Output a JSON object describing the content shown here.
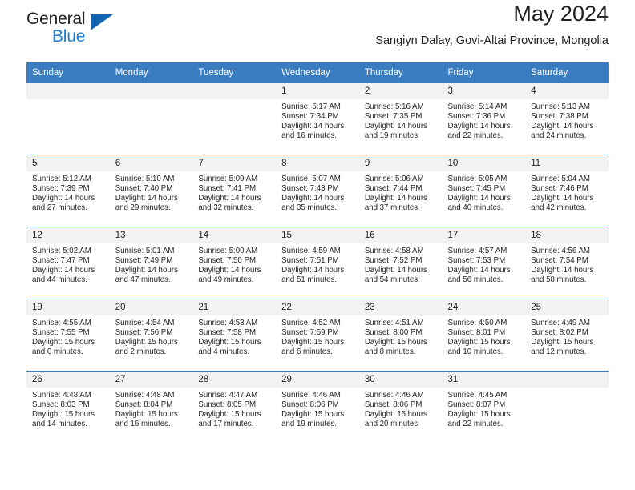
{
  "brand": {
    "name_top": "General",
    "name_bottom": "Blue",
    "accent_color": "#1263b0",
    "accent_color_light": "#1b7fd4"
  },
  "header": {
    "month_title": "May 2024",
    "location": "Sangiyn Dalay, Govi-Altai Province, Mongolia"
  },
  "theme": {
    "header_bg": "#3a7cc0",
    "daynum_bg": "#f2f2f2",
    "text_color": "#231f20"
  },
  "weekday_headers": [
    "Sunday",
    "Monday",
    "Tuesday",
    "Wednesday",
    "Thursday",
    "Friday",
    "Saturday"
  ],
  "labels": {
    "sunrise_prefix": "Sunrise:",
    "sunset_prefix": "Sunset:",
    "daylight_prefix": "Daylight:"
  },
  "weeks": [
    [
      {
        "day": "",
        "sunrise": "",
        "sunset": "",
        "daylight": "",
        "empty": true
      },
      {
        "day": "",
        "sunrise": "",
        "sunset": "",
        "daylight": "",
        "empty": true
      },
      {
        "day": "",
        "sunrise": "",
        "sunset": "",
        "daylight": "",
        "empty": true
      },
      {
        "day": "1",
        "sunrise": "Sunrise: 5:17 AM",
        "sunset": "Sunset: 7:34 PM",
        "daylight": "Daylight: 14 hours and 16 minutes."
      },
      {
        "day": "2",
        "sunrise": "Sunrise: 5:16 AM",
        "sunset": "Sunset: 7:35 PM",
        "daylight": "Daylight: 14 hours and 19 minutes."
      },
      {
        "day": "3",
        "sunrise": "Sunrise: 5:14 AM",
        "sunset": "Sunset: 7:36 PM",
        "daylight": "Daylight: 14 hours and 22 minutes."
      },
      {
        "day": "4",
        "sunrise": "Sunrise: 5:13 AM",
        "sunset": "Sunset: 7:38 PM",
        "daylight": "Daylight: 14 hours and 24 minutes."
      }
    ],
    [
      {
        "day": "5",
        "sunrise": "Sunrise: 5:12 AM",
        "sunset": "Sunset: 7:39 PM",
        "daylight": "Daylight: 14 hours and 27 minutes."
      },
      {
        "day": "6",
        "sunrise": "Sunrise: 5:10 AM",
        "sunset": "Sunset: 7:40 PM",
        "daylight": "Daylight: 14 hours and 29 minutes."
      },
      {
        "day": "7",
        "sunrise": "Sunrise: 5:09 AM",
        "sunset": "Sunset: 7:41 PM",
        "daylight": "Daylight: 14 hours and 32 minutes."
      },
      {
        "day": "8",
        "sunrise": "Sunrise: 5:07 AM",
        "sunset": "Sunset: 7:43 PM",
        "daylight": "Daylight: 14 hours and 35 minutes."
      },
      {
        "day": "9",
        "sunrise": "Sunrise: 5:06 AM",
        "sunset": "Sunset: 7:44 PM",
        "daylight": "Daylight: 14 hours and 37 minutes."
      },
      {
        "day": "10",
        "sunrise": "Sunrise: 5:05 AM",
        "sunset": "Sunset: 7:45 PM",
        "daylight": "Daylight: 14 hours and 40 minutes."
      },
      {
        "day": "11",
        "sunrise": "Sunrise: 5:04 AM",
        "sunset": "Sunset: 7:46 PM",
        "daylight": "Daylight: 14 hours and 42 minutes."
      }
    ],
    [
      {
        "day": "12",
        "sunrise": "Sunrise: 5:02 AM",
        "sunset": "Sunset: 7:47 PM",
        "daylight": "Daylight: 14 hours and 44 minutes."
      },
      {
        "day": "13",
        "sunrise": "Sunrise: 5:01 AM",
        "sunset": "Sunset: 7:49 PM",
        "daylight": "Daylight: 14 hours and 47 minutes."
      },
      {
        "day": "14",
        "sunrise": "Sunrise: 5:00 AM",
        "sunset": "Sunset: 7:50 PM",
        "daylight": "Daylight: 14 hours and 49 minutes."
      },
      {
        "day": "15",
        "sunrise": "Sunrise: 4:59 AM",
        "sunset": "Sunset: 7:51 PM",
        "daylight": "Daylight: 14 hours and 51 minutes."
      },
      {
        "day": "16",
        "sunrise": "Sunrise: 4:58 AM",
        "sunset": "Sunset: 7:52 PM",
        "daylight": "Daylight: 14 hours and 54 minutes."
      },
      {
        "day": "17",
        "sunrise": "Sunrise: 4:57 AM",
        "sunset": "Sunset: 7:53 PM",
        "daylight": "Daylight: 14 hours and 56 minutes."
      },
      {
        "day": "18",
        "sunrise": "Sunrise: 4:56 AM",
        "sunset": "Sunset: 7:54 PM",
        "daylight": "Daylight: 14 hours and 58 minutes."
      }
    ],
    [
      {
        "day": "19",
        "sunrise": "Sunrise: 4:55 AM",
        "sunset": "Sunset: 7:55 PM",
        "daylight": "Daylight: 15 hours and 0 minutes."
      },
      {
        "day": "20",
        "sunrise": "Sunrise: 4:54 AM",
        "sunset": "Sunset: 7:56 PM",
        "daylight": "Daylight: 15 hours and 2 minutes."
      },
      {
        "day": "21",
        "sunrise": "Sunrise: 4:53 AM",
        "sunset": "Sunset: 7:58 PM",
        "daylight": "Daylight: 15 hours and 4 minutes."
      },
      {
        "day": "22",
        "sunrise": "Sunrise: 4:52 AM",
        "sunset": "Sunset: 7:59 PM",
        "daylight": "Daylight: 15 hours and 6 minutes."
      },
      {
        "day": "23",
        "sunrise": "Sunrise: 4:51 AM",
        "sunset": "Sunset: 8:00 PM",
        "daylight": "Daylight: 15 hours and 8 minutes."
      },
      {
        "day": "24",
        "sunrise": "Sunrise: 4:50 AM",
        "sunset": "Sunset: 8:01 PM",
        "daylight": "Daylight: 15 hours and 10 minutes."
      },
      {
        "day": "25",
        "sunrise": "Sunrise: 4:49 AM",
        "sunset": "Sunset: 8:02 PM",
        "daylight": "Daylight: 15 hours and 12 minutes."
      }
    ],
    [
      {
        "day": "26",
        "sunrise": "Sunrise: 4:48 AM",
        "sunset": "Sunset: 8:03 PM",
        "daylight": "Daylight: 15 hours and 14 minutes."
      },
      {
        "day": "27",
        "sunrise": "Sunrise: 4:48 AM",
        "sunset": "Sunset: 8:04 PM",
        "daylight": "Daylight: 15 hours and 16 minutes."
      },
      {
        "day": "28",
        "sunrise": "Sunrise: 4:47 AM",
        "sunset": "Sunset: 8:05 PM",
        "daylight": "Daylight: 15 hours and 17 minutes."
      },
      {
        "day": "29",
        "sunrise": "Sunrise: 4:46 AM",
        "sunset": "Sunset: 8:06 PM",
        "daylight": "Daylight: 15 hours and 19 minutes."
      },
      {
        "day": "30",
        "sunrise": "Sunrise: 4:46 AM",
        "sunset": "Sunset: 8:06 PM",
        "daylight": "Daylight: 15 hours and 20 minutes."
      },
      {
        "day": "31",
        "sunrise": "Sunrise: 4:45 AM",
        "sunset": "Sunset: 8:07 PM",
        "daylight": "Daylight: 15 hours and 22 minutes."
      },
      {
        "day": "",
        "sunrise": "",
        "sunset": "",
        "daylight": "",
        "empty": true
      }
    ]
  ]
}
